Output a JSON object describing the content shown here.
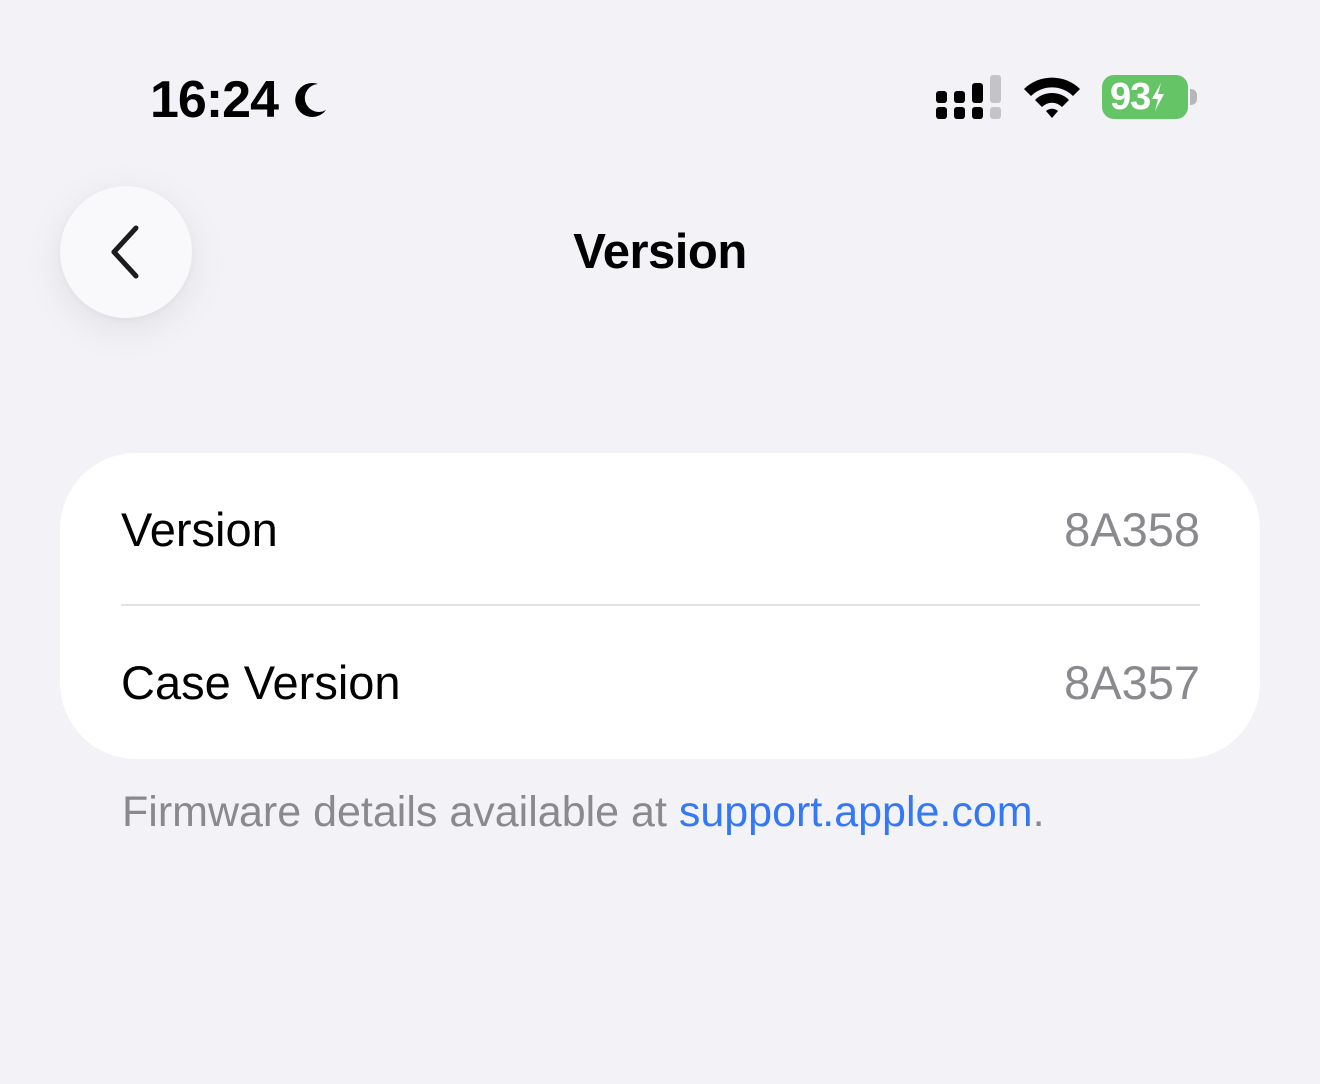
{
  "status_bar": {
    "time": "16:24",
    "focus_icon": "moon-icon",
    "signal_icon": "cellular-signal-icon",
    "wifi_icon": "wifi-icon",
    "battery_level": "93",
    "battery_icon": "battery-charging-icon",
    "battery_color": "#65c466"
  },
  "nav": {
    "back_icon": "chevron-left-icon",
    "title": "Version"
  },
  "rows": [
    {
      "label": "Version",
      "value": "8A358"
    },
    {
      "label": "Case Version",
      "value": "8A357"
    }
  ],
  "footer": {
    "text": "Firmware details available at ",
    "link_text": "support.apple.com",
    "suffix": ".",
    "link_color": "#3478f6"
  }
}
